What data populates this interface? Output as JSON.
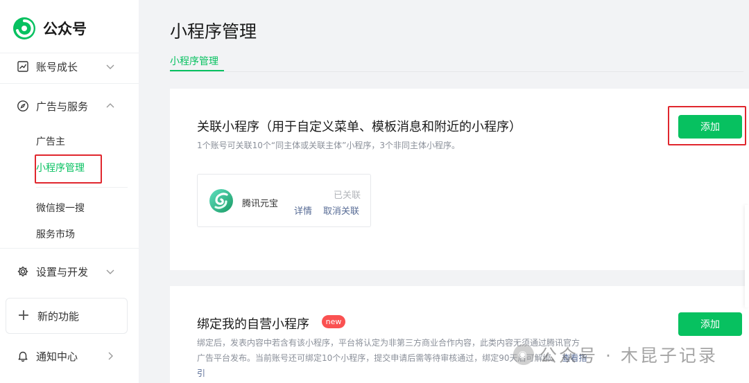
{
  "sidebar": {
    "logo_text": "公众号",
    "groups": [
      {
        "label": "账号成长",
        "icon": "trend-chart-icon",
        "chevron": "down"
      },
      {
        "label": "广告与服务",
        "icon": "compass-icon",
        "chevron": "up"
      },
      {
        "label": "设置与开发",
        "icon": "gear-icon",
        "chevron": "down"
      }
    ],
    "ads_sub": [
      "广告主",
      "小程序管理",
      "微信搜一搜",
      "服务市场"
    ],
    "new_feature": "新的功能",
    "notification": "通知中心"
  },
  "main": {
    "title": "小程序管理",
    "tab": "小程序管理",
    "section1": {
      "title": "关联小程序（用于自定义菜单、模板消息和附近的小程序）",
      "desc": "1个账号可关联10个“同主体或关联主体”小程序，3个非同主体小程序。",
      "add_button": "添加",
      "linked_app": {
        "name": "腾讯元宝",
        "status": "已关联",
        "detail_link": "详情",
        "unlink_link": "取消关联"
      }
    },
    "section2": {
      "title": "绑定我的自营小程序",
      "badge": "new",
      "desc_line1": "绑定后，发表内容中若含有该小程序，平台将认定为非第三方商业合作内容，此类内容无须通过腾讯官方",
      "desc_line2": "广告平台发布。当前账号还可绑定10个小程序，提交申请后需等待审核通过，绑定90天后可解绑。",
      "guide_link": "查看指",
      "guide_link_tail": "引",
      "add_button": "添加"
    }
  },
  "watermark": "公众号 · 木昆子记录",
  "colors": {
    "brand_green": "#07c160",
    "highlight_red": "#e0262d",
    "link_blue": "#576b95",
    "badge_red": "#fa5151"
  }
}
